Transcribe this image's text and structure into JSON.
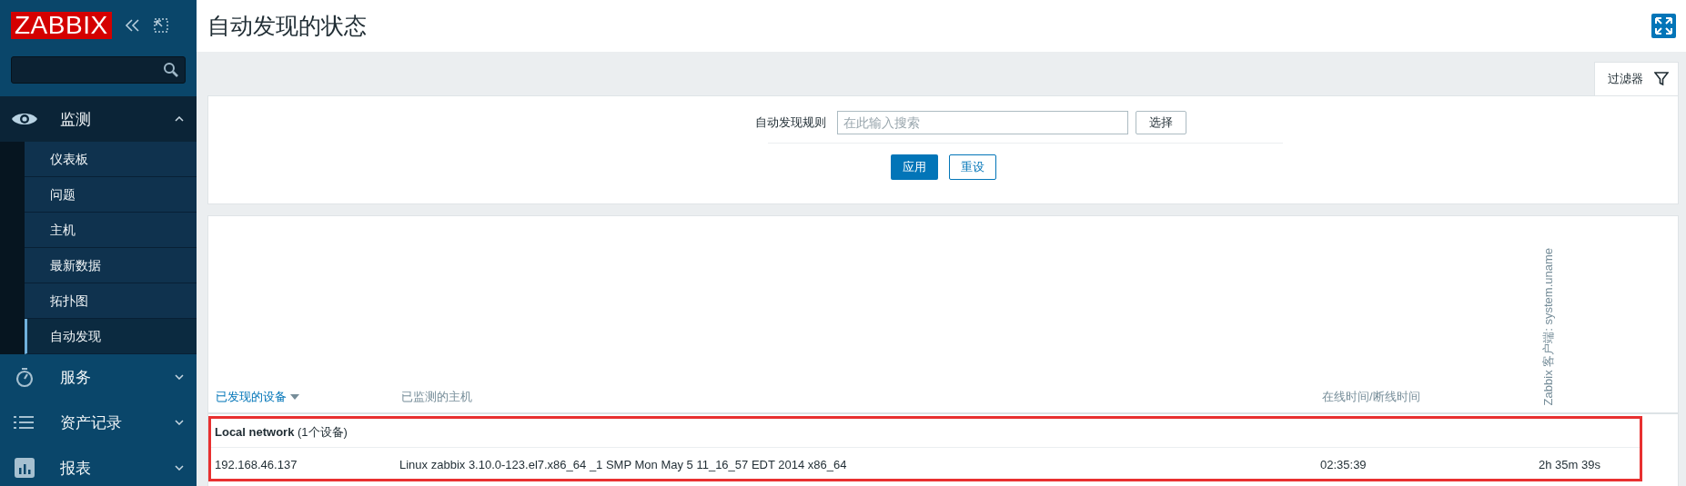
{
  "sidebar": {
    "logo": "ZABBIX",
    "menu": [
      {
        "kind": "eye",
        "label": "监测",
        "expanded": true,
        "children": [
          {
            "label": "仪表板",
            "selected": false
          },
          {
            "label": "问题",
            "selected": false
          },
          {
            "label": "主机",
            "selected": false
          },
          {
            "label": "最新数据",
            "selected": false
          },
          {
            "label": "拓扑图",
            "selected": false
          },
          {
            "label": "自动发现",
            "selected": true
          }
        ]
      },
      {
        "kind": "timer",
        "label": "服务",
        "expanded": false
      },
      {
        "kind": "list",
        "label": "资产记录",
        "expanded": false
      },
      {
        "kind": "chart",
        "label": "报表",
        "expanded": false
      }
    ]
  },
  "page": {
    "title": "自动发现的状态"
  },
  "filter": {
    "tab": "过滤器",
    "rule_label": "自动发现规则",
    "rule_field": {
      "placeholder": "在此输入搜索"
    },
    "select_button": "选择",
    "apply_button": "应用",
    "reset_button": "重设"
  },
  "table": {
    "columns": [
      {
        "label": "已发现的设备",
        "sorted": true,
        "vertical": false
      },
      {
        "label": "已监测的主机",
        "sorted": false,
        "vertical": false
      },
      {
        "label": "在线时间/断线时间",
        "sorted": false,
        "vertical": false
      },
      {
        "label": "Zabbix 客户端: system.uname",
        "sorted": false,
        "vertical": true
      }
    ],
    "groups": [
      {
        "name": "Local network",
        "count": "(1个设备)",
        "highlighted": true,
        "rows": [
          {
            "cells": [
              "192.168.46.137",
              "Linux zabbix 3.10.0-123.el7.x86_64 _1 SMP Mon May 5 11_16_57 EDT 2014 x86_64",
              "02:35:39",
              "2h 35m 39s"
            ]
          }
        ]
      }
    ]
  }
}
